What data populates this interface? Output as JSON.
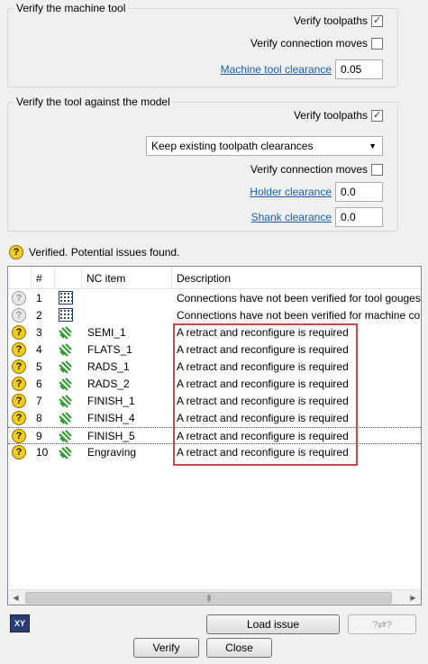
{
  "machine_group": {
    "title": "Verify the machine tool",
    "verify_toolpaths_label": "Verify toolpaths",
    "verify_toolpaths_checked": true,
    "verify_connection_label": "Verify connection moves",
    "verify_connection_checked": false,
    "clearance_label": "Machine tool clearance",
    "clearance_value": "0.05"
  },
  "model_group": {
    "title": "Verify the tool against the model",
    "verify_toolpaths_label": "Verify toolpaths",
    "verify_toolpaths_checked": true,
    "clearance_mode": "Keep existing toolpath clearances",
    "verify_connection_label": "Verify connection moves",
    "verify_connection_checked": false,
    "holder_label": "Holder clearance",
    "holder_value": "0.0",
    "shank_label": "Shank clearance",
    "shank_value": "0.0"
  },
  "status": {
    "text": "Verified. Potential issues found.",
    "icon": "question-icon"
  },
  "table": {
    "headers": {
      "num": "#",
      "item": "NC item",
      "desc": "Description"
    },
    "rows": [
      {
        "num": "1",
        "item": "",
        "desc": "Connections have not been verified for tool gouges",
        "status": "unverified",
        "type": "connections"
      },
      {
        "num": "2",
        "item": "",
        "desc": "Connections have not been verified for machine co",
        "status": "unverified",
        "type": "connections"
      },
      {
        "num": "3",
        "item": "SEMI_1",
        "desc": "A retract and reconfigure is required",
        "status": "issue",
        "type": "toolpath"
      },
      {
        "num": "4",
        "item": "FLATS_1",
        "desc": "A retract and reconfigure is required",
        "status": "issue",
        "type": "toolpath"
      },
      {
        "num": "5",
        "item": "RADS_1",
        "desc": "A retract and reconfigure is required",
        "status": "issue",
        "type": "toolpath"
      },
      {
        "num": "6",
        "item": "RADS_2",
        "desc": "A retract and reconfigure is required",
        "status": "issue",
        "type": "toolpath"
      },
      {
        "num": "7",
        "item": "FINISH_1",
        "desc": "A retract and reconfigure is required",
        "status": "issue",
        "type": "toolpath"
      },
      {
        "num": "8",
        "item": "FINISH_4",
        "desc": "A retract and reconfigure is required",
        "status": "issue",
        "type": "toolpath"
      },
      {
        "num": "9",
        "item": "FINISH_5",
        "desc": "A retract and reconfigure is required",
        "status": "issue",
        "type": "toolpath"
      },
      {
        "num": "10",
        "item": "Engraving",
        "desc": "A retract and reconfigure is required",
        "status": "issue",
        "type": "toolpath"
      }
    ]
  },
  "buttons": {
    "load_issue": "Load issue",
    "verify": "Verify",
    "close": "Close"
  },
  "colors": {
    "highlight": "#d04646",
    "link": "#1a5fb4",
    "warning": "#f2cb1d"
  }
}
